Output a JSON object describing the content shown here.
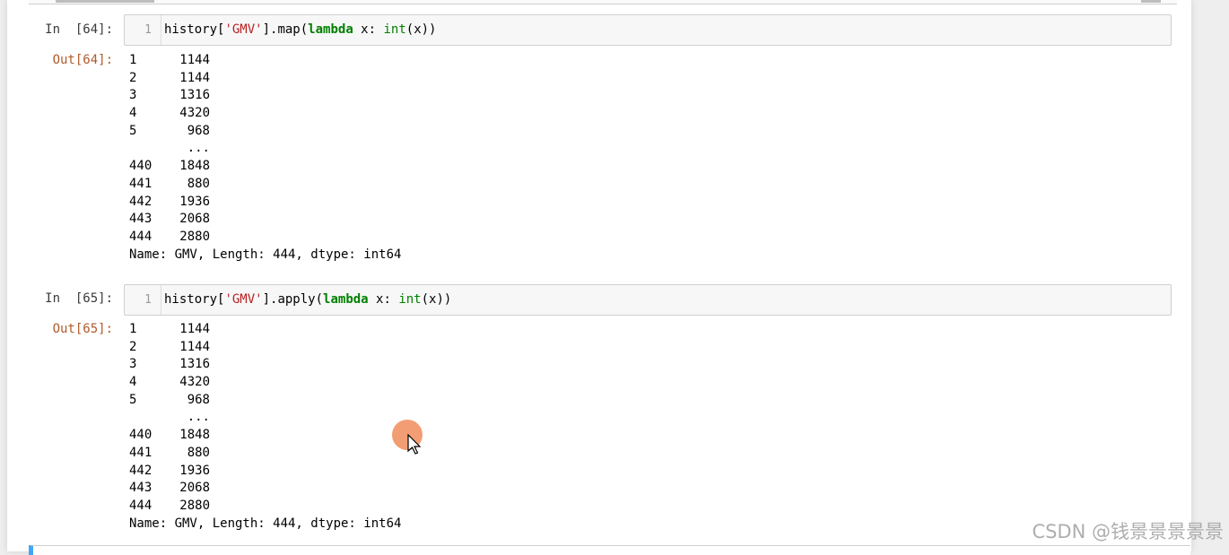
{
  "cells": [
    {
      "in_prompt": "In  [64]:",
      "line_number": "1",
      "code_tokens": [
        {
          "text": "history[",
          "cls": ""
        },
        {
          "text": "'GMV'",
          "cls": "str"
        },
        {
          "text": "].map(",
          "cls": ""
        },
        {
          "text": "lambda",
          "cls": "kw"
        },
        {
          "text": " x: ",
          "cls": ""
        },
        {
          "text": "int",
          "cls": "bi"
        },
        {
          "text": "(x))",
          "cls": ""
        }
      ],
      "out_prompt": "Out[64]:",
      "rows": [
        {
          "idx": "1",
          "val": "1144"
        },
        {
          "idx": "2",
          "val": "1144"
        },
        {
          "idx": "3",
          "val": "1316"
        },
        {
          "idx": "4",
          "val": "4320"
        },
        {
          "idx": "5",
          "val": "968"
        },
        {
          "idx": "",
          "val": "..."
        },
        {
          "idx": "440",
          "val": "1848"
        },
        {
          "idx": "441",
          "val": "880"
        },
        {
          "idx": "442",
          "val": "1936"
        },
        {
          "idx": "443",
          "val": "2068"
        },
        {
          "idx": "444",
          "val": "2880"
        }
      ],
      "summary": "Name: GMV, Length: 444, dtype: int64"
    },
    {
      "in_prompt": "In  [65]:",
      "line_number": "1",
      "code_tokens": [
        {
          "text": "history[",
          "cls": ""
        },
        {
          "text": "'GMV'",
          "cls": "str"
        },
        {
          "text": "].apply(",
          "cls": ""
        },
        {
          "text": "lambda",
          "cls": "kw"
        },
        {
          "text": " x: ",
          "cls": ""
        },
        {
          "text": "int",
          "cls": "bi"
        },
        {
          "text": "(x))",
          "cls": ""
        }
      ],
      "out_prompt": "Out[65]:",
      "rows": [
        {
          "idx": "1",
          "val": "1144"
        },
        {
          "idx": "2",
          "val": "1144"
        },
        {
          "idx": "3",
          "val": "1316"
        },
        {
          "idx": "4",
          "val": "4320"
        },
        {
          "idx": "5",
          "val": "968"
        },
        {
          "idx": "",
          "val": "..."
        },
        {
          "idx": "440",
          "val": "1848"
        },
        {
          "idx": "441",
          "val": "880"
        },
        {
          "idx": "442",
          "val": "1936"
        },
        {
          "idx": "443",
          "val": "2068"
        },
        {
          "idx": "444",
          "val": "2880"
        }
      ],
      "summary": "Name: GMV, Length: 444, dtype: int64"
    }
  ],
  "watermark": "CSDN @钱景景景景景",
  "colors": {
    "keyword": "#008000",
    "string": "#ba2121",
    "out_prompt": "#b05a2a",
    "cursor_highlight": "#f08c5a",
    "selected_cell_bar": "#42a5f5"
  },
  "icons": {
    "mouse_cursor": "arrow-pointer-icon"
  }
}
